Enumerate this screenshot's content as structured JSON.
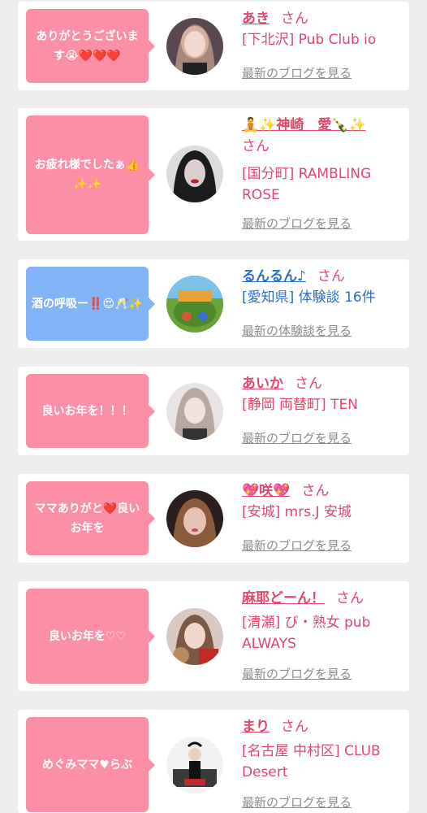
{
  "entries": [
    {
      "message": "ありがとうございます😭❤️❤️❤️",
      "name": "あき",
      "honorific": "さん",
      "shop": "[下北沢] Pub Club io",
      "link": "最新のブログを見る",
      "bubble_color": "#fb8fa5"
    },
    {
      "message": "お疲れ様でしたぁ👍✨✨",
      "name": "🧘✨神崎　愛🍾✨",
      "honorific": "さん",
      "shop": "[国分町] RAMBLING ROSE",
      "link": "最新のブログを見る",
      "bubble_color": "#fb8fa5"
    },
    {
      "message": "酒の呼吸ー‼️😍🥂✨",
      "name": "るんるん♪",
      "honorific": "さん",
      "shop": "[愛知県] 体験談 16件",
      "link": "最新の体験談を見る",
      "bubble_color": "#82b3f6"
    },
    {
      "message": "良いお年を！！！",
      "name": "あいか",
      "honorific": "さん",
      "shop": "[静岡 両替町] TEN",
      "link": "最新のブログを見る",
      "bubble_color": "#fb8fa5"
    },
    {
      "message": "ママありがと❤️良いお年を",
      "name": "💖咲💖",
      "honorific": "さん",
      "shop": "[安城] mrs.J 安城",
      "link": "最新のブログを見る",
      "bubble_color": "#fb8fa5"
    },
    {
      "message": "良いお年を♡♡",
      "name": "麻耶どーん！",
      "honorific": "さん",
      "shop": "[清瀬] び・熟女 pub ALWAYS",
      "link": "最新のブログを見る",
      "bubble_color": "#fb8fa5"
    },
    {
      "message": "めぐみママ♥らぶ",
      "name": "まり",
      "honorific": "さん",
      "shop": "[名古屋 中村区] CLUB Desert",
      "link": "最新のブログを見る",
      "bubble_color": "#fb8fa5"
    }
  ],
  "colors": {
    "page_bg": "#eeeeee",
    "card_bg": "#ffffff",
    "pink_text": "#e0476a",
    "blue_text": "#2c6fc9",
    "link_gray": "#8c8c8c"
  }
}
